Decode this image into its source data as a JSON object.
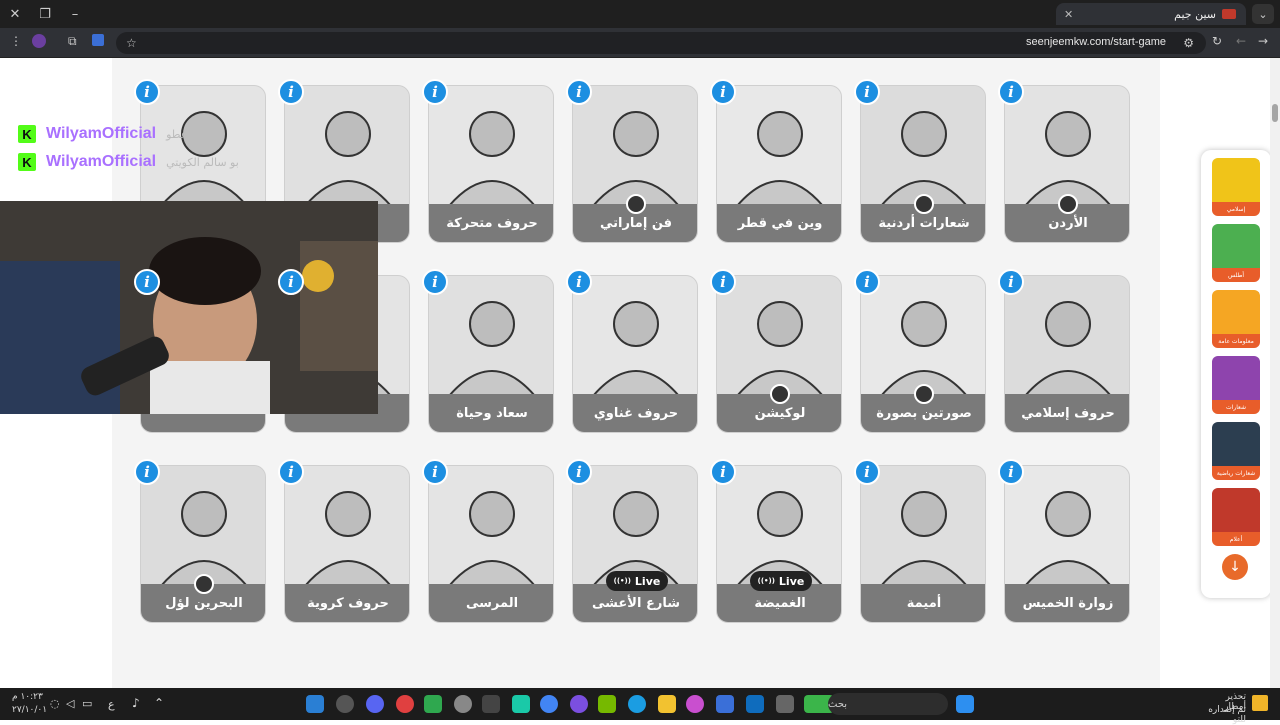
{
  "browser": {
    "tab_title": "سين جيم",
    "url": "seenjeemkw.com/start-game"
  },
  "grid": {
    "cards": [
      {
        "label": "الأردن",
        "live": false,
        "flag": true
      },
      {
        "label": "شعارات أردنية",
        "live": false,
        "flag": true
      },
      {
        "label": "وين في قطر",
        "live": false,
        "flag": false
      },
      {
        "label": "فن إماراتي",
        "live": false,
        "flag": true
      },
      {
        "label": "حروف متحركة",
        "live": false,
        "flag": false
      },
      {
        "label": "",
        "live": false,
        "flag": false
      },
      {
        "label": "",
        "live": false,
        "flag": false
      },
      {
        "label": "حروف إسلامي",
        "live": false,
        "flag": false
      },
      {
        "label": "صورتين بصورة",
        "live": false,
        "flag": true
      },
      {
        "label": "لوكيشن",
        "live": false,
        "flag": true
      },
      {
        "label": "حروف غناوي",
        "live": false,
        "flag": false
      },
      {
        "label": "سعاد وحياة",
        "live": false,
        "flag": false
      },
      {
        "label": "",
        "live": false,
        "flag": false
      },
      {
        "label": "",
        "live": false,
        "flag": false
      },
      {
        "label": "زوارة الخميس",
        "live": false,
        "flag": false
      },
      {
        "label": "أميمة",
        "live": false,
        "flag": false
      },
      {
        "label": "الغميضة",
        "live": true,
        "flag": false
      },
      {
        "label": "شارع الأعشى",
        "live": true,
        "flag": false
      },
      {
        "label": "المرسى",
        "live": false,
        "flag": false
      },
      {
        "label": "حروف كروية",
        "live": false,
        "flag": false
      },
      {
        "label": "البحرين لؤل",
        "live": false,
        "flag": true
      }
    ],
    "live_label": "Live",
    "info_glyph": "i"
  },
  "chat": {
    "messages": [
      {
        "user": "WilyamOfficial",
        "badge": "K",
        "text": "عطو"
      },
      {
        "user": "WilyamOfficial",
        "badge": "K",
        "text": "بو سالم الكويتي"
      }
    ]
  },
  "sidebar": {
    "items": [
      {
        "label": "إسلامي",
        "color": "#f0c419"
      },
      {
        "label": "أطلس",
        "color": "#4caf50"
      },
      {
        "label": "معلومات عامة",
        "color": "#f5a623"
      },
      {
        "label": "شعارات",
        "color": "#8e44ad"
      },
      {
        "label": "شعارات رياضية",
        "color": "#2c3e50"
      },
      {
        "label": "أعلام",
        "color": "#c0392b"
      }
    ],
    "down_glyph": "↓"
  },
  "taskbar": {
    "search_placeholder": "بحث",
    "time": "١٠:٢٣ م",
    "date": "٢٧/١٠/٠١",
    "weather_title": "تحذير أمطار",
    "weather_sub": "تم إصداره للتو",
    "lang": "ع"
  },
  "colors": {
    "info_blue": "#1d8fe1",
    "label_gray": "#7a7a7a",
    "kick_green": "#53fc18",
    "chat_purple": "#a970ff"
  }
}
